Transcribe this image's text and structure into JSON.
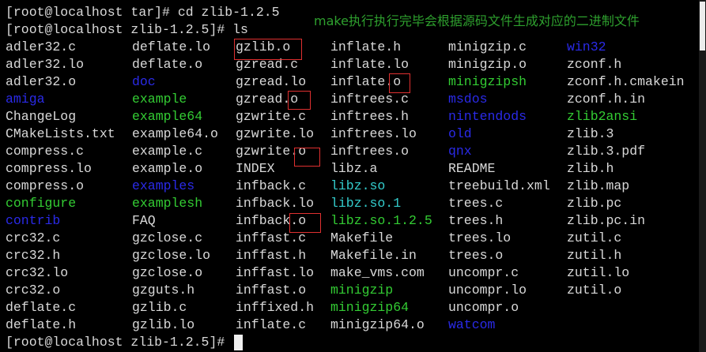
{
  "colors": {
    "default_text": "#d9d9d9",
    "directory": "#2a2ae8",
    "executable": "#33cc33",
    "symlink": "#33cccc",
    "annotation": "#2ea02e",
    "highlight_box": "#e03030",
    "background": "#000000"
  },
  "prompt_lines": [
    "[root@localhost tar]# cd zlib-1.2.5",
    "[root@localhost zlib-1.2.5]# ls"
  ],
  "final_prompt": "[root@localhost zlib-1.2.5]#",
  "annotation": "make执行执行完毕会根据源码文件生成对应的二进制文件",
  "listing": [
    [
      {
        "t": "adler32.c",
        "k": "f"
      },
      {
        "t": "deflate.lo",
        "k": "f"
      },
      {
        "t": "gzlib.o",
        "k": "f"
      },
      {
        "t": "inflate.h",
        "k": "f"
      },
      {
        "t": "minigzip.c",
        "k": "f"
      },
      {
        "t": "win32",
        "k": "d"
      }
    ],
    [
      {
        "t": "adler32.lo",
        "k": "f"
      },
      {
        "t": "deflate.o",
        "k": "f"
      },
      {
        "t": "gzread.c",
        "k": "f"
      },
      {
        "t": "inflate.lo",
        "k": "f"
      },
      {
        "t": "minigzip.o",
        "k": "f"
      },
      {
        "t": "zconf.h",
        "k": "f"
      }
    ],
    [
      {
        "t": "adler32.o",
        "k": "f"
      },
      {
        "t": "doc",
        "k": "d"
      },
      {
        "t": "gzread.lo",
        "k": "f"
      },
      {
        "t": "inflate.o",
        "k": "f"
      },
      {
        "t": "minigzipsh",
        "k": "x"
      },
      {
        "t": "zconf.h.cmakein",
        "k": "f"
      }
    ],
    [
      {
        "t": "amiga",
        "k": "d"
      },
      {
        "t": "example",
        "k": "x"
      },
      {
        "t": "gzread.o",
        "k": "f"
      },
      {
        "t": "inftrees.c",
        "k": "f"
      },
      {
        "t": "msdos",
        "k": "d"
      },
      {
        "t": "zconf.h.in",
        "k": "f"
      }
    ],
    [
      {
        "t": "ChangeLog",
        "k": "f"
      },
      {
        "t": "example64",
        "k": "x"
      },
      {
        "t": "gzwrite.c",
        "k": "f"
      },
      {
        "t": "inftrees.h",
        "k": "f"
      },
      {
        "t": "nintendods",
        "k": "d"
      },
      {
        "t": "zlib2ansi",
        "k": "x"
      }
    ],
    [
      {
        "t": "CMakeLists.txt",
        "k": "f"
      },
      {
        "t": "example64.o",
        "k": "f"
      },
      {
        "t": "gzwrite.lo",
        "k": "f"
      },
      {
        "t": "inftrees.lo",
        "k": "f"
      },
      {
        "t": "old",
        "k": "d"
      },
      {
        "t": "zlib.3",
        "k": "f"
      }
    ],
    [
      {
        "t": "compress.c",
        "k": "f"
      },
      {
        "t": "example.c",
        "k": "f"
      },
      {
        "t": "gzwrite.o",
        "k": "f"
      },
      {
        "t": "inftrees.o",
        "k": "f"
      },
      {
        "t": "qnx",
        "k": "d"
      },
      {
        "t": "zlib.3.pdf",
        "k": "f"
      }
    ],
    [
      {
        "t": "compress.lo",
        "k": "f"
      },
      {
        "t": "example.o",
        "k": "f"
      },
      {
        "t": "INDEX",
        "k": "f"
      },
      {
        "t": "libz.a",
        "k": "f"
      },
      {
        "t": "README",
        "k": "f"
      },
      {
        "t": "zlib.h",
        "k": "f"
      }
    ],
    [
      {
        "t": "compress.o",
        "k": "f"
      },
      {
        "t": "examples",
        "k": "d"
      },
      {
        "t": "infback.c",
        "k": "f"
      },
      {
        "t": "libz.so",
        "k": "l"
      },
      {
        "t": "treebuild.xml",
        "k": "f"
      },
      {
        "t": "zlib.map",
        "k": "f"
      }
    ],
    [
      {
        "t": "configure",
        "k": "x"
      },
      {
        "t": "examplesh",
        "k": "x"
      },
      {
        "t": "infback.lo",
        "k": "f"
      },
      {
        "t": "libz.so.1",
        "k": "l"
      },
      {
        "t": "trees.c",
        "k": "f"
      },
      {
        "t": "zlib.pc",
        "k": "f"
      }
    ],
    [
      {
        "t": "contrib",
        "k": "d"
      },
      {
        "t": "FAQ",
        "k": "f"
      },
      {
        "t": "infback.o",
        "k": "f"
      },
      {
        "t": "libz.so.1.2.5",
        "k": "x"
      },
      {
        "t": "trees.h",
        "k": "f"
      },
      {
        "t": "zlib.pc.in",
        "k": "f"
      }
    ],
    [
      {
        "t": "crc32.c",
        "k": "f"
      },
      {
        "t": "gzclose.c",
        "k": "f"
      },
      {
        "t": "inffast.c",
        "k": "f"
      },
      {
        "t": "Makefile",
        "k": "f"
      },
      {
        "t": "trees.lo",
        "k": "f"
      },
      {
        "t": "zutil.c",
        "k": "f"
      }
    ],
    [
      {
        "t": "crc32.h",
        "k": "f"
      },
      {
        "t": "gzclose.lo",
        "k": "f"
      },
      {
        "t": "inffast.h",
        "k": "f"
      },
      {
        "t": "Makefile.in",
        "k": "f"
      },
      {
        "t": "trees.o",
        "k": "f"
      },
      {
        "t": "zutil.h",
        "k": "f"
      }
    ],
    [
      {
        "t": "crc32.lo",
        "k": "f"
      },
      {
        "t": "gzclose.o",
        "k": "f"
      },
      {
        "t": "inffast.lo",
        "k": "f"
      },
      {
        "t": "make_vms.com",
        "k": "f"
      },
      {
        "t": "uncompr.c",
        "k": "f"
      },
      {
        "t": "zutil.lo",
        "k": "f"
      }
    ],
    [
      {
        "t": "crc32.o",
        "k": "f"
      },
      {
        "t": "gzguts.h",
        "k": "f"
      },
      {
        "t": "inffast.o",
        "k": "f"
      },
      {
        "t": "minigzip",
        "k": "x"
      },
      {
        "t": "uncompr.lo",
        "k": "f"
      },
      {
        "t": "zutil.o",
        "k": "f"
      }
    ],
    [
      {
        "t": "deflate.c",
        "k": "f"
      },
      {
        "t": "gzlib.c",
        "k": "f"
      },
      {
        "t": "inffixed.h",
        "k": "f"
      },
      {
        "t": "minigzip64",
        "k": "x"
      },
      {
        "t": "uncompr.o",
        "k": "f"
      },
      {
        "t": "",
        "k": "f"
      }
    ],
    [
      {
        "t": "deflate.h",
        "k": "f"
      },
      {
        "t": "gzlib.lo",
        "k": "f"
      },
      {
        "t": "inflate.c",
        "k": "f"
      },
      {
        "t": "minigzip64.o",
        "k": "f"
      },
      {
        "t": "watcom",
        "k": "d"
      },
      {
        "t": "",
        "k": "f"
      }
    ]
  ]
}
